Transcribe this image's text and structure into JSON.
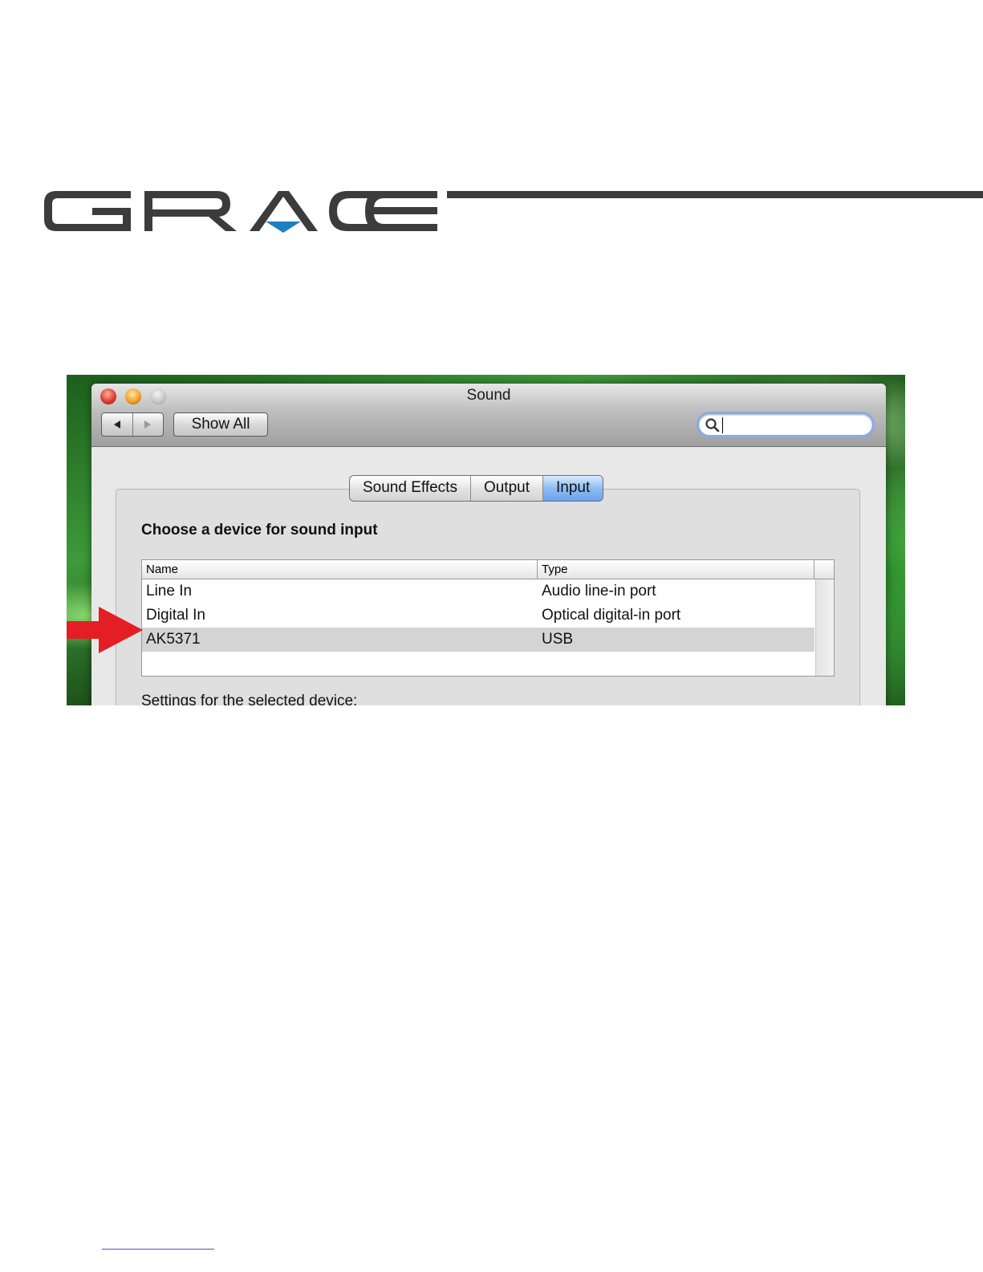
{
  "brand": {
    "logo_text": "GRACE"
  },
  "window": {
    "title": "Sound"
  },
  "toolbar": {
    "back_icon": "back-arrow-icon",
    "forward_icon": "forward-arrow-icon",
    "show_all_label": "Show All",
    "search": {
      "value": "",
      "placeholder": ""
    }
  },
  "tabs": [
    {
      "label": "Sound Effects",
      "active": false
    },
    {
      "label": "Output",
      "active": false
    },
    {
      "label": "Input",
      "active": true
    }
  ],
  "input_panel": {
    "heading": "Choose a device for sound input",
    "columns": [
      "Name",
      "Type"
    ],
    "rows": [
      {
        "name": "Line In",
        "type": "Audio line-in port",
        "selected": false
      },
      {
        "name": "Digital In",
        "type": "Optical digital-in port",
        "selected": false
      },
      {
        "name": "AK5371",
        "type": "USB",
        "selected": true
      }
    ],
    "settings_label": "Settings for the selected device:"
  },
  "colors": {
    "logo_gray": "#3c3c3c",
    "logo_accent": "#1f7fc4",
    "arrow_red": "#e31e24",
    "selection": "#d4d4d4",
    "active_tab": "#8fbcf3"
  }
}
